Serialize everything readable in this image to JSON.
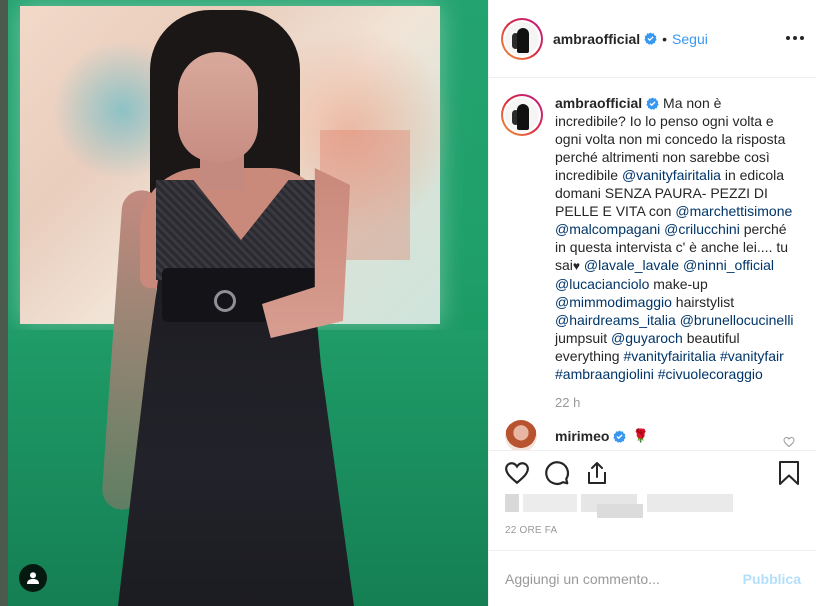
{
  "post": {
    "username": "ambraofficial",
    "follow_label": "Segui",
    "separator": "•",
    "more_icon": "more-options-icon",
    "verified_color": "#3897f0"
  },
  "caption": {
    "username": "ambraofficial",
    "part1": "Ma non è incredibile? Io lo penso ogni volta e ogni volta non mi concedo la risposta perché altrimenti non sarebbe così incredibile ",
    "mention_vanity": "@vanityfairitalia",
    "part2": " in edicola domani SENZA PAURA- PEZZI DI PELLE E VITA con ",
    "mention_marchetti": "@marchettisimone",
    "space1": " ",
    "mention_malcom": "@malcompagani",
    "space2": " ",
    "mention_cri": "@crilucchini",
    "part3": " perché in questa intervista c' è anche lei.... tu sai",
    "heart": "♥",
    "space3": " ",
    "mention_lavale": "@lavale_lavale",
    "space4": " ",
    "mention_ninni": "@ninni_official",
    "space5": " ",
    "mention_luca": "@lucacianciolo",
    "part4": " make-up ",
    "mention_mimmo": "@mimmodimaggio",
    "part5": " hairstylist ",
    "mention_hair": "@hairdreams_italia",
    "space6": " ",
    "mention_brunello": "@brunellocucinelli",
    "part6": " jumpsuit ",
    "mention_guyaroch": "@guyaroch",
    "part7": " beautiful everything ",
    "tag1": "#vanityfairitalia",
    "space7": " ",
    "tag2": "#vanityfair",
    "space8": " ",
    "tag3": "#ambraangiolini",
    "space9": " ",
    "tag4": "#civuolecoraggio",
    "time_ago": "22 h"
  },
  "comment": {
    "username": "mirimeo",
    "text": "🌹"
  },
  "actions": {
    "like_icon": "heart-icon",
    "comment_icon": "comment-icon",
    "share_icon": "share-icon",
    "save_icon": "bookmark-icon"
  },
  "date_label": "22 ORE FA",
  "add_comment": {
    "placeholder": "Aggiungi un commento...",
    "publish_label": "Pubblica"
  },
  "colors": {
    "link": "#003569",
    "follow": "#3897f0",
    "publish_disabled": "#b2dffc",
    "muted": "#999999"
  }
}
